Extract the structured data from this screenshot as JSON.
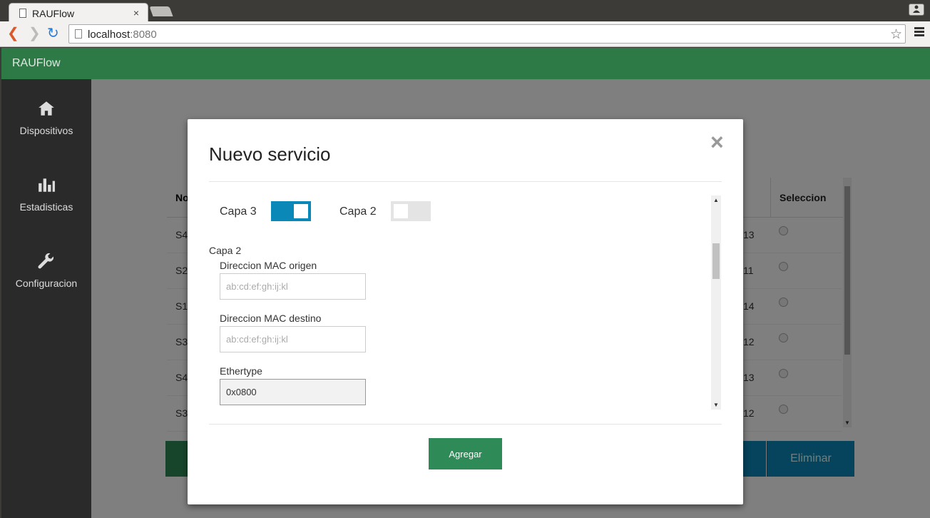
{
  "browser": {
    "tab_title": "RAUFlow",
    "tab_close": "×",
    "url_host": "localhost",
    "url_port": ":8080",
    "bookmark_glyph": "☆",
    "profile_glyph": "👤",
    "back_glyph": "❮",
    "forward_glyph": "❯",
    "reload_glyph": "↻"
  },
  "app": {
    "brand": "RAUFlow",
    "sidebar": [
      {
        "label": "Dispositivos",
        "icon": "home-icon"
      },
      {
        "label": "Estadisticas",
        "icon": "bar-chart-icon"
      },
      {
        "label": "Configuracion",
        "icon": "wrench-icon"
      }
    ]
  },
  "table": {
    "col_first_header": "No",
    "col_select_header": "Seleccion",
    "rows": [
      {
        "c1": "S4",
        "c2": "13"
      },
      {
        "c1": "S2",
        "c2": "11"
      },
      {
        "c1": "S1",
        "c2": "14"
      },
      {
        "c1": "S3",
        "c2": "12"
      },
      {
        "c1": "S4",
        "c2": "13"
      },
      {
        "c1": "S3",
        "c2": "12"
      }
    ],
    "delete_button": "Eliminar"
  },
  "modal": {
    "title": "Nuevo servicio",
    "close_glyph": "×",
    "toggle_capa3": {
      "label": "Capa 3",
      "state": "on"
    },
    "toggle_capa2": {
      "label": "Capa 2",
      "state": "off"
    },
    "section_label": "Capa 2",
    "mac_origen": {
      "label": "Direccion MAC origen",
      "placeholder": "ab:cd:ef:gh:ij:kl",
      "value": ""
    },
    "mac_destino": {
      "label": "Direccion MAC destino",
      "placeholder": "ab:cd:ef:gh:ij:kl",
      "value": ""
    },
    "ethertype": {
      "label": "Ethertype",
      "value": "0x0800"
    },
    "submit_label": "Agregar"
  },
  "colors": {
    "brand_green": "#2e7a47",
    "toggle_on": "#0a88b8",
    "button_green": "#2e8b57"
  }
}
